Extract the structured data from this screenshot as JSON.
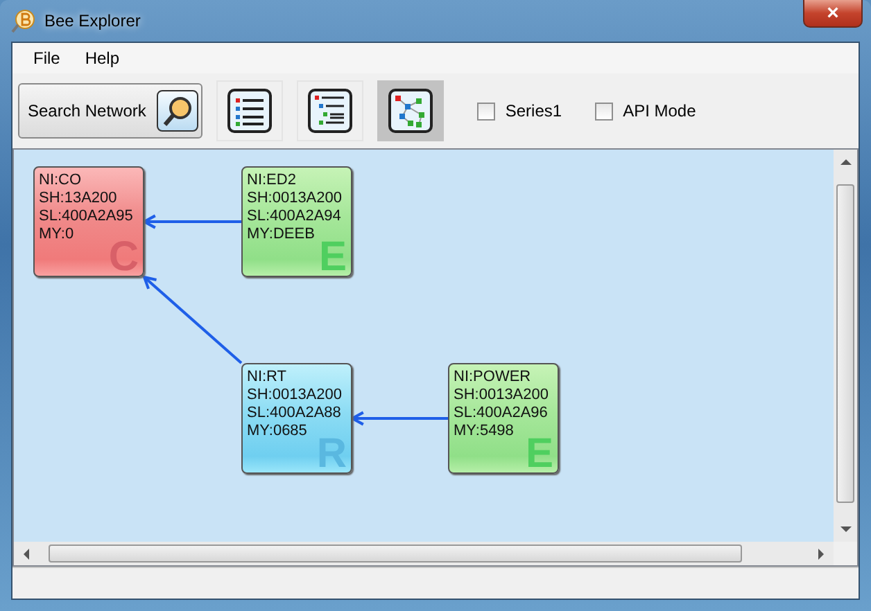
{
  "window": {
    "title": "Bee Explorer",
    "close": "×"
  },
  "menu": [
    "File",
    "Help"
  ],
  "toolbar": {
    "search_button": "Search Network",
    "views": [
      {
        "kind": "list",
        "selected": false
      },
      {
        "kind": "tree",
        "selected": false
      },
      {
        "kind": "graph",
        "selected": true
      }
    ],
    "checkboxes": [
      {
        "label": "Series1",
        "checked": false
      },
      {
        "label": "API Mode",
        "checked": false
      }
    ]
  },
  "network": {
    "kind": "coordinator",
    "letter": "C",
    "lines": [
      "NI:CO",
      "SH:13A200",
      "SL:400A2A95",
      "MY:0"
    ],
    "children": [
      {
        "kind": "end_device",
        "letter": "E",
        "lines": [
          "NI:ED2",
          "SH:0013A200",
          "SL:400A2A94",
          "MY:DEEB"
        ]
      },
      {
        "kind": "router",
        "letter": "R",
        "lines": [
          "NI:RT",
          "SH:0013A200",
          "SL:400A2A88",
          "MY:0685"
        ],
        "children": [
          {
            "kind": "end_device",
            "letter": "E",
            "lines": [
              "NI:POWER",
              "SH:0013A200",
              "SL:400A2A96",
              "MY:5498"
            ]
          }
        ]
      }
    ]
  }
}
